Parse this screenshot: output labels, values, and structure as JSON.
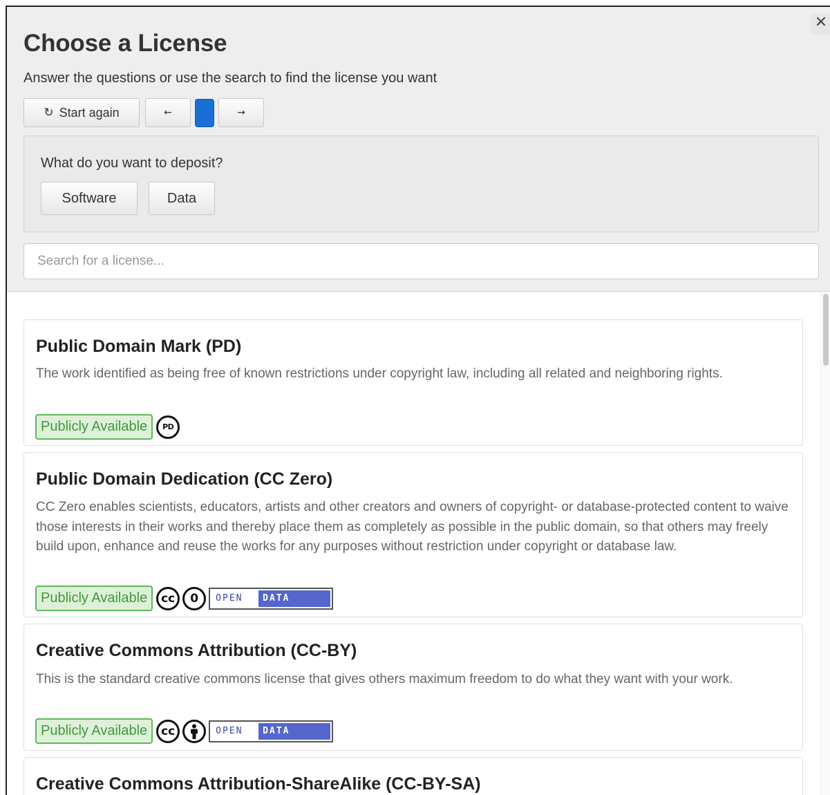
{
  "dialog": {
    "title": "Choose a License",
    "subtitle": "Answer the questions or use the search to find the license you want",
    "close_label": "×"
  },
  "toolbar": {
    "restart_icon": "↻",
    "restart_label": "Start again",
    "prev_label": "←",
    "next_label": "→",
    "progress_fraction": 1
  },
  "question": {
    "text": "What do you want to deposit?",
    "options": [
      "Software",
      "Data"
    ]
  },
  "search": {
    "placeholder": "Search for a license...",
    "value": ""
  },
  "licenses": [
    {
      "name": "Public Domain Mark (PD)",
      "description": "The work identified as being free of known restrictions under copyright law, including all related and neighboring rights.",
      "availability": "Publicly Available",
      "icons": [
        "pd-icon"
      ]
    },
    {
      "name": "Public Domain Dedication (CC Zero)",
      "description": "CC Zero enables scientists, educators, artists and other creators and owners of copyright- or database-protected content to waive those interests in their works and thereby place them as completely as possible in the public domain, so that others may freely build upon, enhance and reuse the works for any purposes without restriction under copyright or database law.",
      "availability": "Publicly Available",
      "icons": [
        "cc-icon",
        "zero-icon",
        "open-data-badge"
      ]
    },
    {
      "name": "Creative Commons Attribution (CC-BY)",
      "description": "This is the standard creative commons license that gives others maximum freedom to do what they want with your work.",
      "availability": "Publicly Available",
      "icons": [
        "cc-icon",
        "attribution-icon",
        "open-data-badge"
      ]
    },
    {
      "name": "Creative Commons Attribution-ShareAlike (CC-BY-SA)"
    }
  ],
  "icon_text": {
    "pd": "PD",
    "cc": "cc",
    "zero": "0",
    "open": "OPEN",
    "data": "DATA"
  },
  "colors": {
    "badge_green": "#5cb85c",
    "progress_blue": "#1a6fd6",
    "open_data_blue": "#5566cc"
  }
}
